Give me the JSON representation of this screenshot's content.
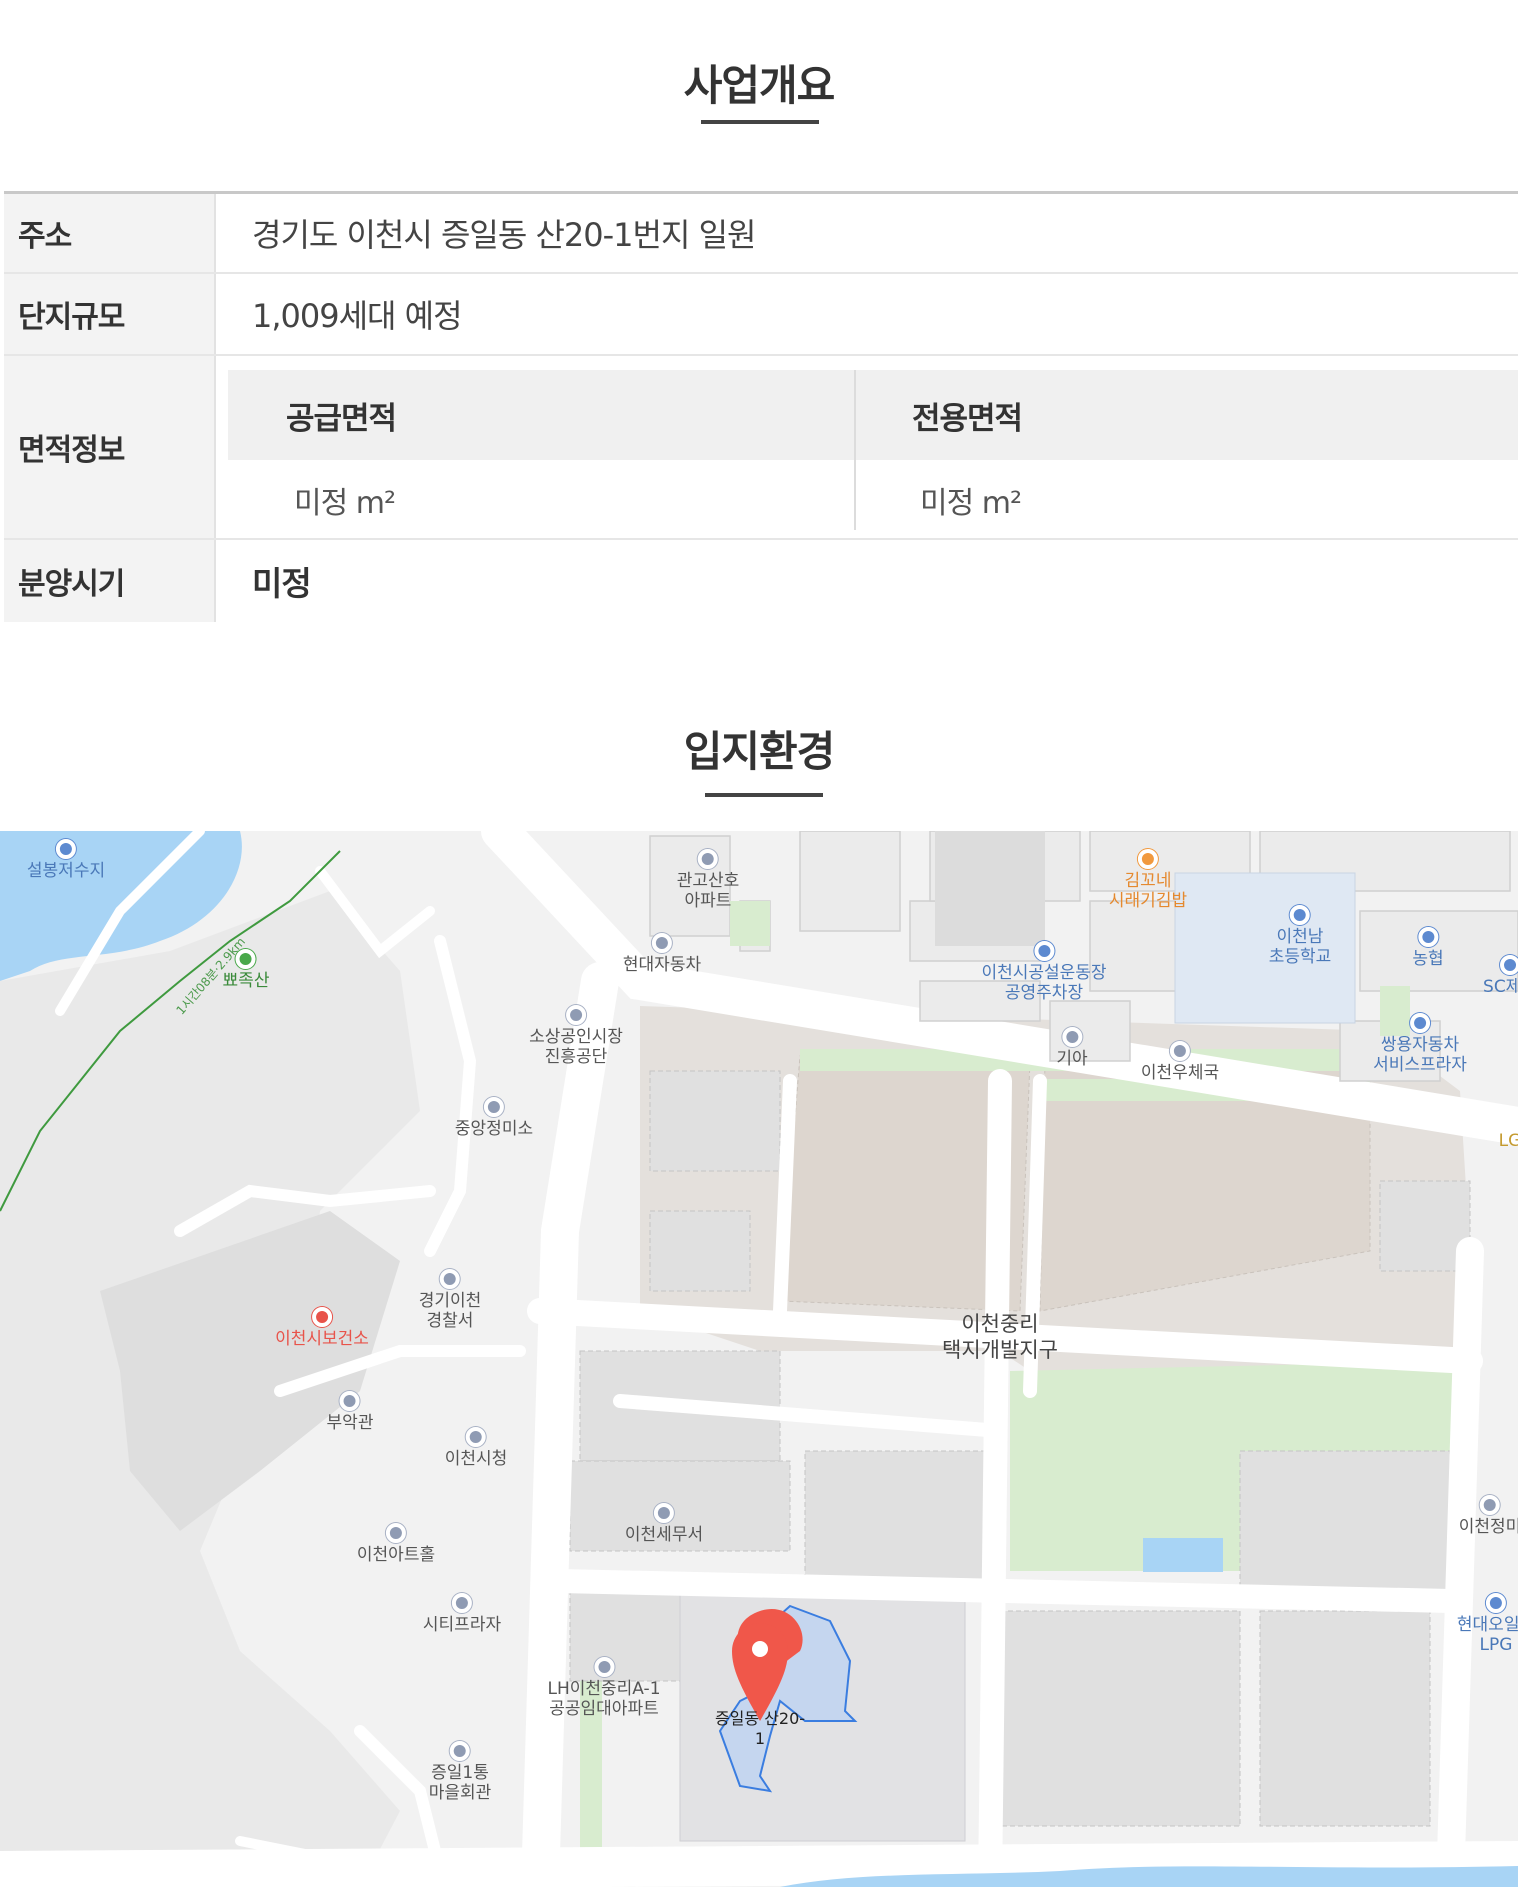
{
  "overview": {
    "title": "사업개요",
    "rows": {
      "address": {
        "label": "주소",
        "value": "경기도 이천시 증일동 산20-1번지 일원"
      },
      "scale": {
        "label": "단지규모",
        "value": "1,009세대 예정"
      },
      "area": {
        "label": "면적정보",
        "supply_label": "공급면적",
        "supply_value": "미정 m²",
        "exclusive_label": "전용면적",
        "exclusive_value": "미정 m²"
      },
      "sale": {
        "label": "분양시기",
        "value": "미정"
      }
    }
  },
  "location": {
    "title": "입지환경",
    "map": {
      "pois": [
        {
          "label": "설봉저수지",
          "kind": "blue"
        },
        {
          "label": "뾰족산",
          "kind": "green"
        },
        {
          "label": "관고산호\n아파트",
          "kind": "gray"
        },
        {
          "label": "현대자동차",
          "kind": "gray"
        },
        {
          "label": "김꼬네\n시래기김밥",
          "kind": "orange"
        },
        {
          "label": "이천남\n초등학교",
          "kind": "blue"
        },
        {
          "label": "농협",
          "kind": "blue"
        },
        {
          "label": "SC제일",
          "kind": "blue"
        },
        {
          "label": "이천시공설운동장\n공영주차장",
          "kind": "blue"
        },
        {
          "label": "소상공인시장\n진흥공단",
          "kind": "gray"
        },
        {
          "label": "기아",
          "kind": "gray"
        },
        {
          "label": "이천우체국",
          "kind": "gray"
        },
        {
          "label": "쌍용자동차\n서비스프라자",
          "kind": "blue"
        },
        {
          "label": "중앙정미소",
          "kind": "gray"
        },
        {
          "label": "경기이천\n경찰서",
          "kind": "gray"
        },
        {
          "label": "이천시보건소",
          "kind": "red"
        },
        {
          "label": "부악관",
          "kind": "gray"
        },
        {
          "label": "이천시청",
          "kind": "gray"
        },
        {
          "label": "이천세무서",
          "kind": "gray"
        },
        {
          "label": "이천아트홀",
          "kind": "gray"
        },
        {
          "label": "시티프라자",
          "kind": "gray"
        },
        {
          "label": "LH이천중리A-1\n공공임대아파트",
          "kind": "gray"
        },
        {
          "label": "증일1통\n마을회관",
          "kind": "gray"
        },
        {
          "label": "이천정미",
          "kind": "gray"
        },
        {
          "label": "현대오일뱅\nLPG",
          "kind": "blue"
        }
      ],
      "district": "이천중리\n택지개발지구",
      "highway": "1시간08분·2.9km",
      "lg_label": "LG",
      "pin_label": "증일동 산20-\n1",
      "colors": {
        "pin": "#f0574a",
        "parcel": "#c5d6ef",
        "parcel_stroke": "#3a7de0",
        "water": "#a8d4f5",
        "park": "#d8eccf"
      }
    }
  }
}
